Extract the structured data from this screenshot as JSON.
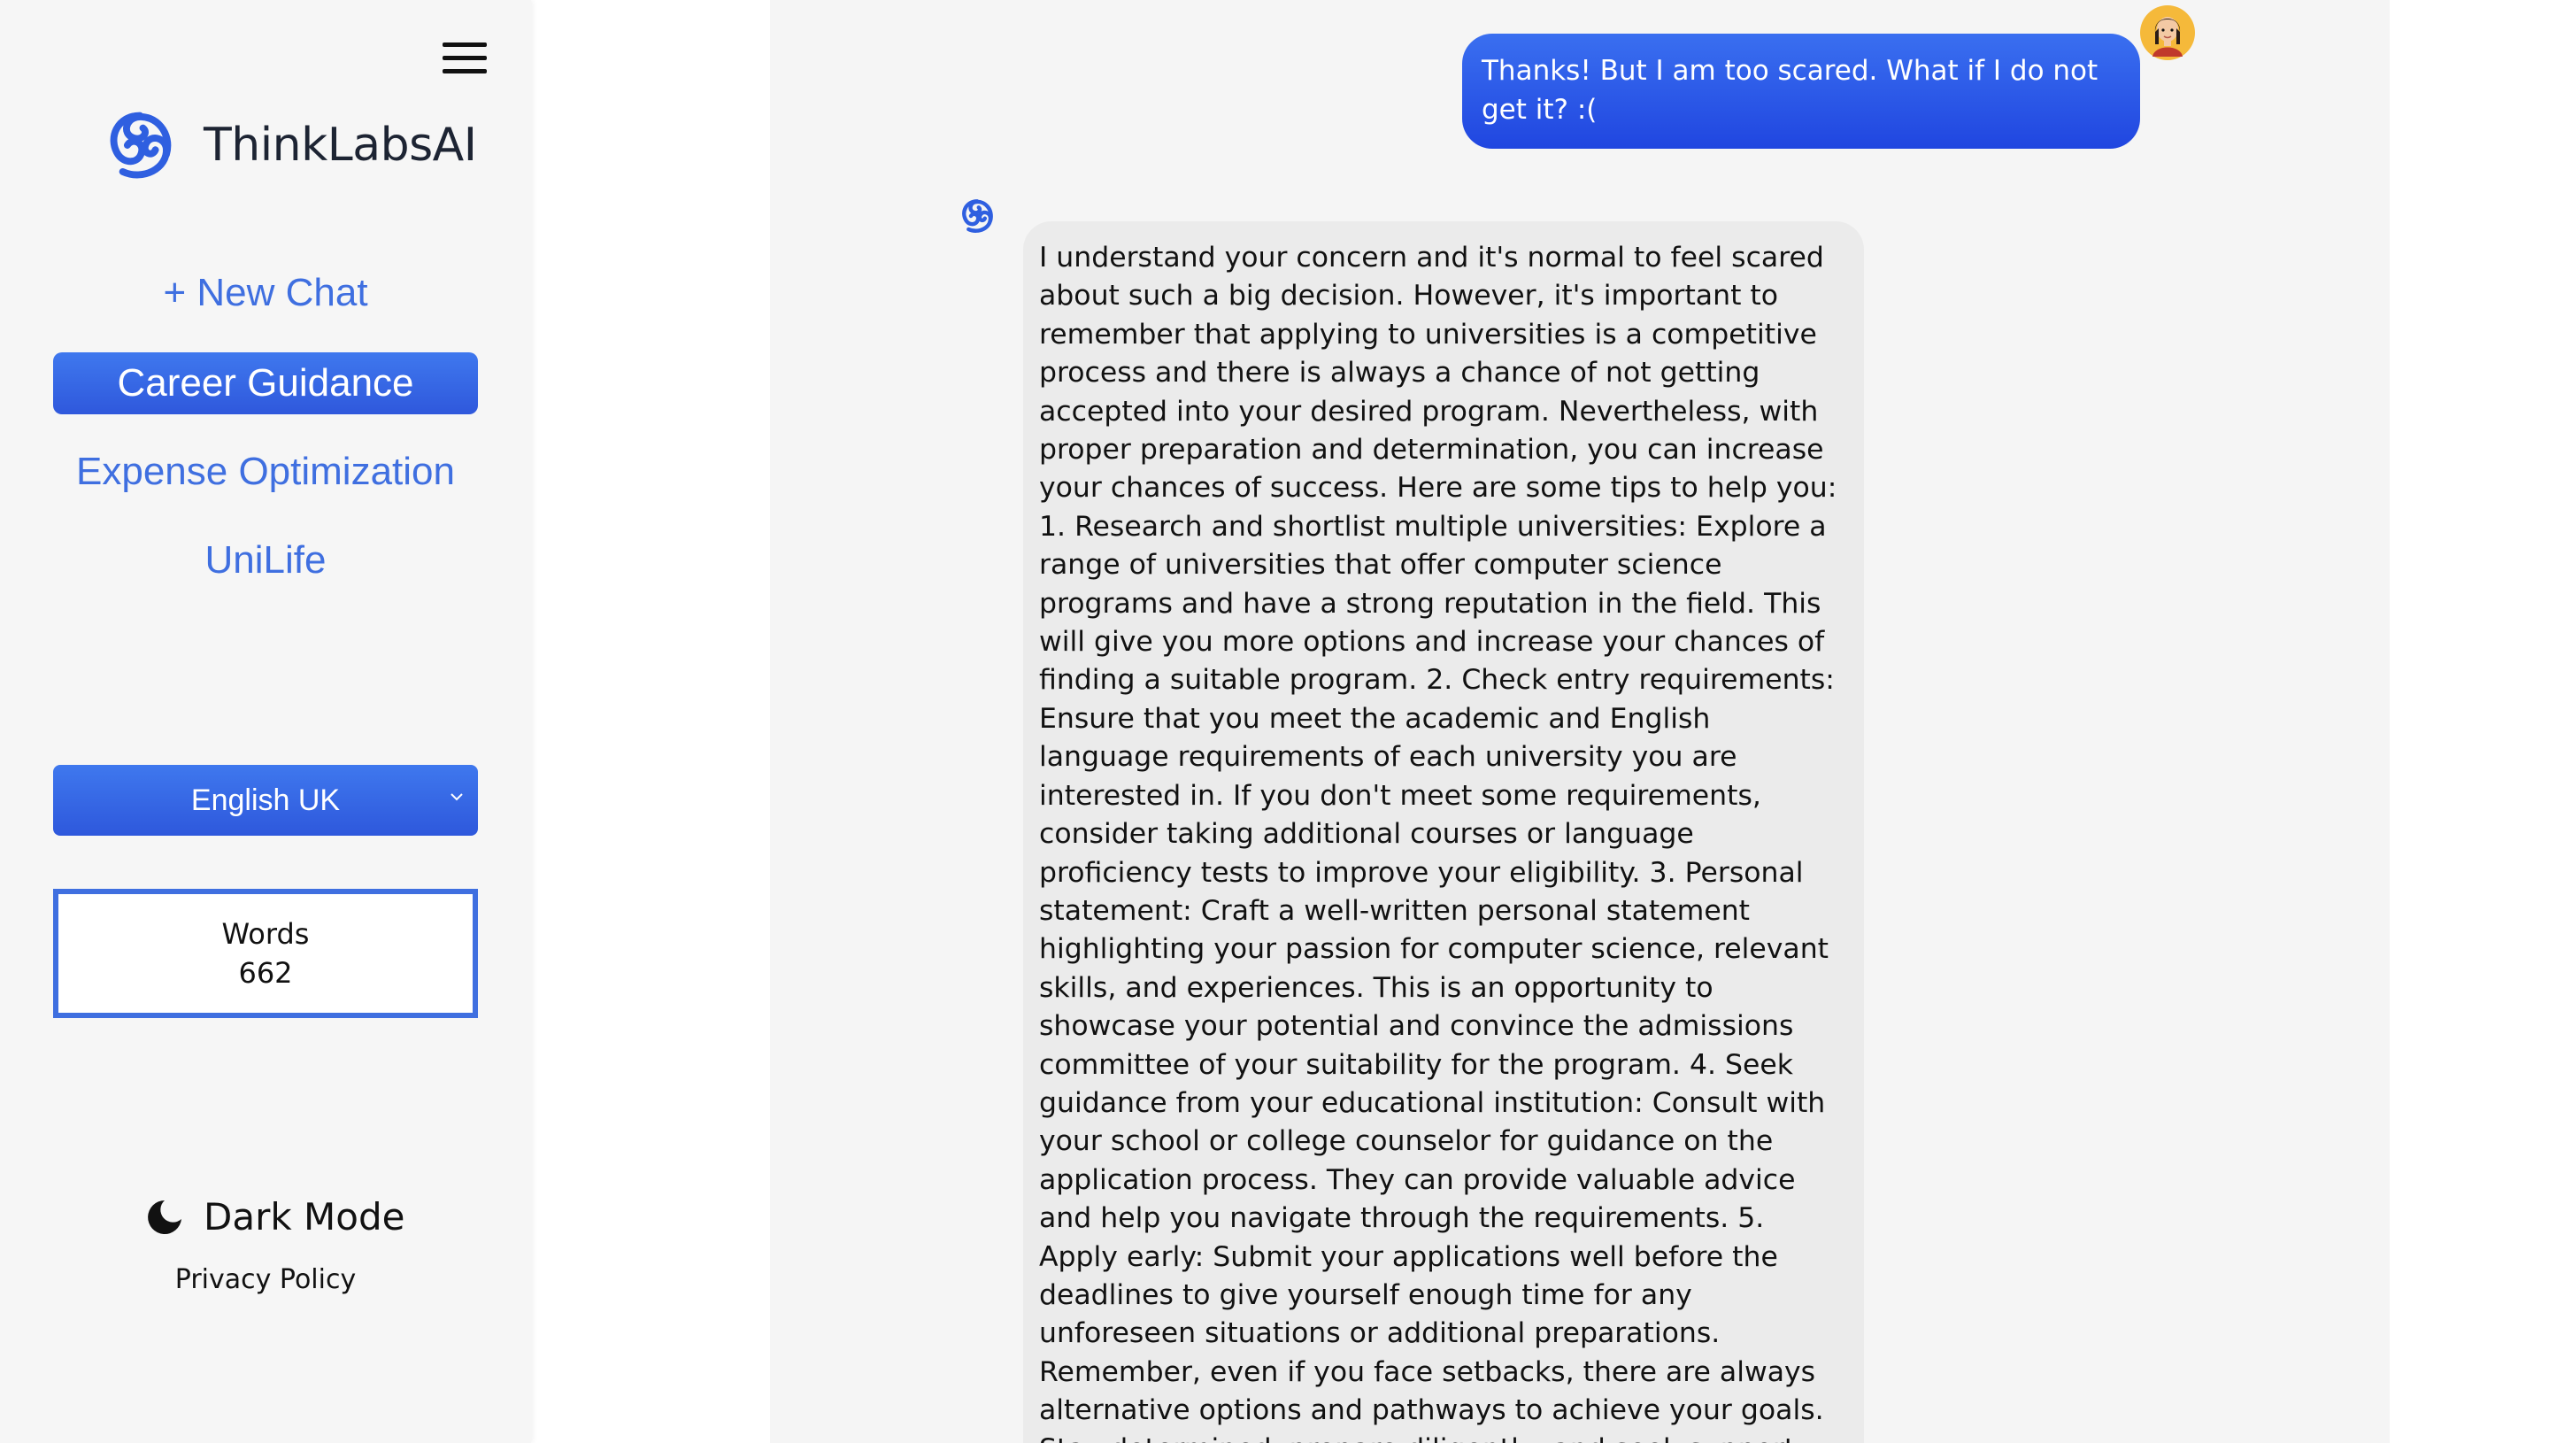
{
  "app": {
    "name": "ThinkLabsAI"
  },
  "sidebar": {
    "menu_icon": "hamburger-menu-icon",
    "logo_icon": "thinklabs-logo-icon",
    "new_chat_label": "+ New Chat",
    "items": [
      {
        "label": "Career Guidance",
        "active": true
      },
      {
        "label": "Expense Optimization",
        "active": false
      },
      {
        "label": "UniLife",
        "active": false
      }
    ],
    "language": {
      "selected": "English UK",
      "icon": "chevron-down-icon"
    },
    "words": {
      "label": "Words",
      "count": "662"
    },
    "dark_mode": {
      "label": "Dark Mode",
      "icon": "moon-icon"
    },
    "privacy_label": "Privacy Policy"
  },
  "chat": {
    "messages": [
      {
        "role": "user",
        "avatar_icon": "user-avatar-icon",
        "text": "Thanks! But I am too scared. What if I do not get it? :("
      },
      {
        "role": "assistant",
        "avatar_icon": "thinklabs-logo-icon",
        "text": "I understand your concern and it's normal to feel scared about such a big decision. However, it's important to remember that applying to universities is a competitive process and there is always a chance of not getting accepted into your desired program. Nevertheless, with proper preparation and determination, you can increase your chances of success. Here are some tips to help you: 1. Research and shortlist multiple universities: Explore a range of universities that offer computer science programs and have a strong reputation in the field. This will give you more options and increase your chances of finding a suitable program. 2. Check entry requirements: Ensure that you meet the academic and English language requirements of each university you are interested in. If you don't meet some requirements, consider taking additional courses or language proficiency tests to improve your eligibility. 3. Personal statement: Craft a well-written personal statement highlighting your passion for computer science, relevant skills, and experiences. This is an opportunity to showcase your potential and convince the admissions committee of your suitability for the program. 4. Seek guidance from your educational institution: Consult with your school or college counselor for guidance on the application process. They can provide valuable advice and help you navigate through the requirements. 5. Apply early: Submit your applications well before the deadlines to give yourself enough time for any unforeseen situations or additional preparations. Remember, even if you face setbacks, there are always alternative options and pathways to achieve your goals. Stay determined, prepare diligently, and seek support from mentors and advisors along the way. Good luck with your application process!"
      }
    ]
  },
  "colors": {
    "accent": "#3f6fe0",
    "accent_dark": "#2046e0",
    "sidebar_bg": "#f6f6f6",
    "chat_bg": "#f5f5f5",
    "bot_bubble_bg": "#ebebeb"
  }
}
